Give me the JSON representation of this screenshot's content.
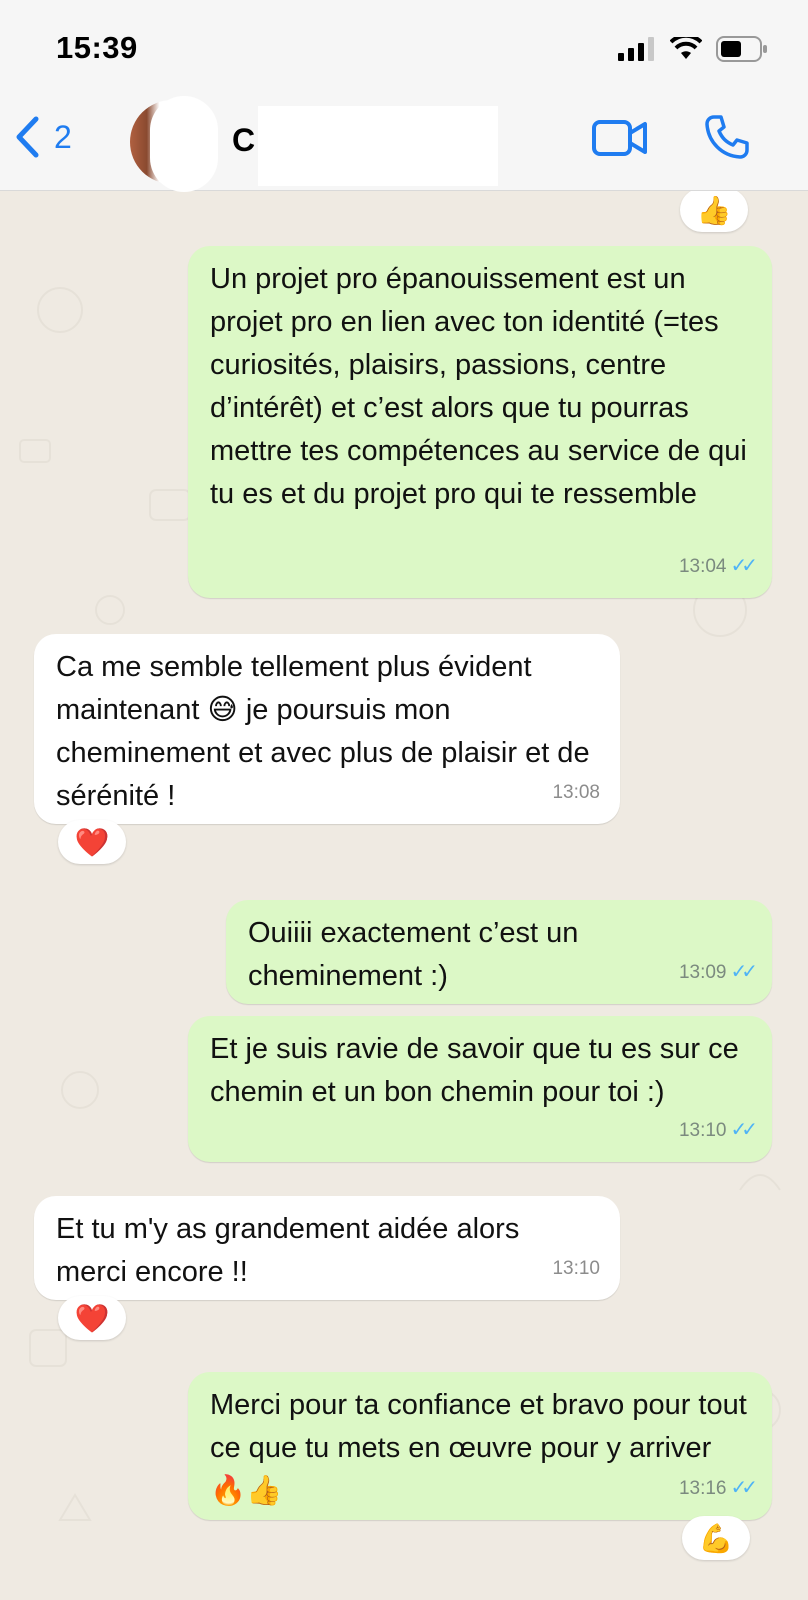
{
  "status_bar": {
    "time": "15:39"
  },
  "header": {
    "back_count": "2",
    "contact_name": "C"
  },
  "messages": [
    {
      "dir": "out",
      "text": "Un projet pro épanouissement est un projet pro en lien avec ton identité (=tes curiosités, plaisirs, passions, centre d’intérêt) et c’est alors que tu pourras mettre tes compétences au service de qui tu es et du projet pro qui te ressemble",
      "time": "13:04"
    },
    {
      "dir": "in",
      "text": "Ca me semble tellement plus évident maintenant 😅 je poursuis mon cheminement et avec plus de plaisir et de sérénité !",
      "time": "13:08",
      "reaction": "❤️"
    },
    {
      "dir": "out",
      "text": "Ouiiii exactement c’est un cheminement :)",
      "time": "13:09"
    },
    {
      "dir": "out",
      "text": "Et je suis ravie de savoir que tu es sur ce chemin et un bon chemin pour toi :)",
      "time": "13:10"
    },
    {
      "dir": "in",
      "text": "Et tu m'y as grandement aidée alors merci encore !!",
      "time": "13:10",
      "reaction": "❤️"
    },
    {
      "dir": "out",
      "text": "Merci pour ta confiance et bravo pour tout ce que tu mets en œuvre pour y arriver 🔥👍",
      "time": "13:16",
      "reaction": "💪"
    }
  ],
  "top_reaction": "👍",
  "icons": {
    "back": "chevron-left-icon",
    "video": "video-camera-icon",
    "call": "phone-icon",
    "read": "double-check-icon"
  },
  "colors": {
    "accent": "#1f7cf0",
    "outgoing_bubble": "#dcf8c6",
    "incoming_bubble": "#ffffff",
    "chat_background": "#efeae2",
    "read_ticks": "#4fb3f6"
  }
}
